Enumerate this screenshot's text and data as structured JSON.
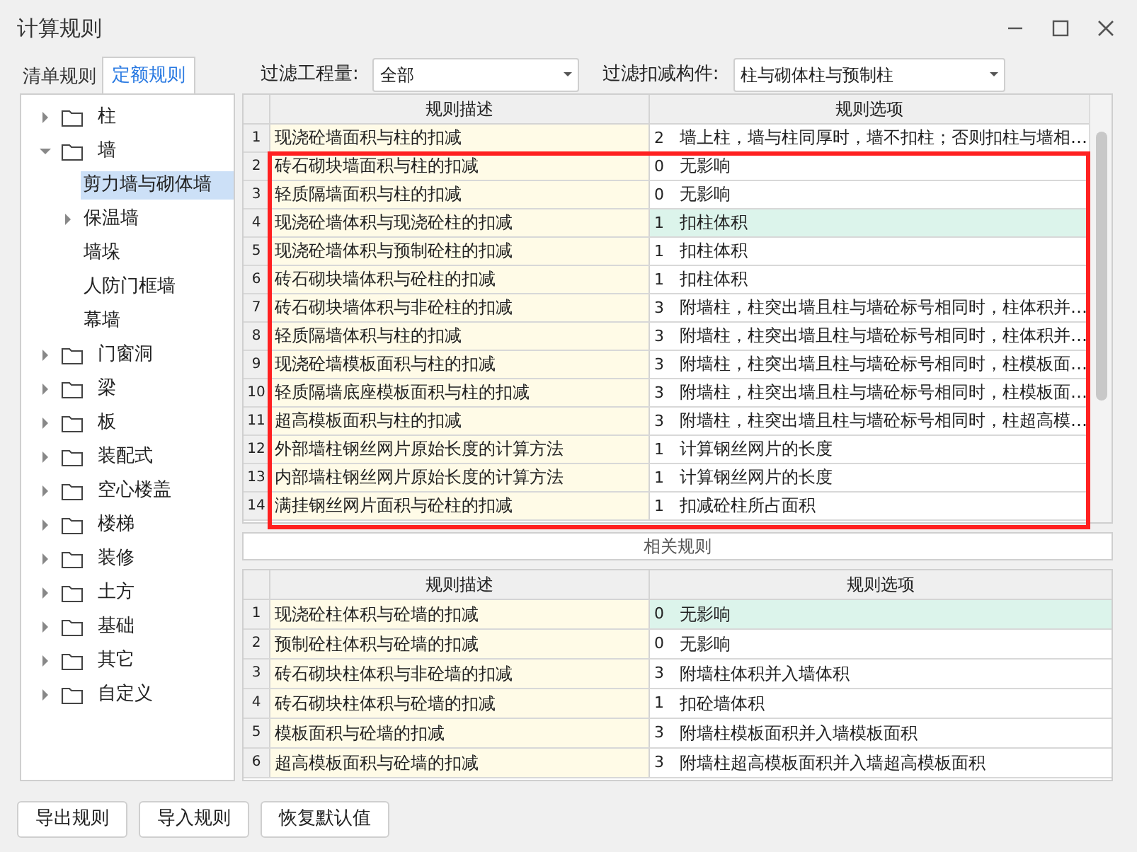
{
  "window": {
    "title": "计算规则"
  },
  "tabs": [
    {
      "label": "清单规则",
      "selected": false
    },
    {
      "label": "定额规则",
      "selected": true
    }
  ],
  "filters": [
    {
      "label": "过滤工程量:",
      "value": "全部"
    },
    {
      "label": "过滤扣减构件:",
      "value": "柱与砌体柱与预制柱"
    }
  ],
  "tree": [
    {
      "label": "柱",
      "folder": true,
      "has_children": true,
      "expanded": false,
      "selected": false
    },
    {
      "label": "墙",
      "folder": true,
      "has_children": true,
      "expanded": true,
      "selected": false,
      "children": [
        {
          "label": "剪力墙与砌体墙",
          "folder": false,
          "has_children": false,
          "expanded": false,
          "selected": true
        },
        {
          "label": "保温墙",
          "folder": false,
          "has_children": true,
          "expanded": false,
          "selected": false
        },
        {
          "label": "墙垛",
          "folder": false,
          "has_children": false,
          "expanded": false,
          "selected": false
        },
        {
          "label": "人防门框墙",
          "folder": false,
          "has_children": false,
          "expanded": false,
          "selected": false
        },
        {
          "label": "幕墙",
          "folder": false,
          "has_children": false,
          "expanded": false,
          "selected": false
        }
      ]
    },
    {
      "label": "门窗洞",
      "folder": true,
      "has_children": true,
      "expanded": false,
      "selected": false
    },
    {
      "label": "梁",
      "folder": true,
      "has_children": true,
      "expanded": false,
      "selected": false
    },
    {
      "label": "板",
      "folder": true,
      "has_children": true,
      "expanded": false,
      "selected": false
    },
    {
      "label": "装配式",
      "folder": true,
      "has_children": true,
      "expanded": false,
      "selected": false
    },
    {
      "label": "空心楼盖",
      "folder": true,
      "has_children": true,
      "expanded": false,
      "selected": false
    },
    {
      "label": "楼梯",
      "folder": true,
      "has_children": true,
      "expanded": false,
      "selected": false
    },
    {
      "label": "装修",
      "folder": true,
      "has_children": true,
      "expanded": false,
      "selected": false
    },
    {
      "label": "土方",
      "folder": true,
      "has_children": true,
      "expanded": false,
      "selected": false
    },
    {
      "label": "基础",
      "folder": true,
      "has_children": true,
      "expanded": false,
      "selected": false
    },
    {
      "label": "其它",
      "folder": true,
      "has_children": true,
      "expanded": false,
      "selected": false
    },
    {
      "label": "自定义",
      "folder": true,
      "has_children": true,
      "expanded": false,
      "selected": false
    }
  ],
  "rules_table": {
    "columns": [
      "规则描述",
      "规则选项"
    ],
    "rows": [
      {
        "index": "1",
        "description": "现浇砼墙面积与柱的扣减",
        "code": "2",
        "option": "墙上柱，墙与柱同厚时，墙不扣柱；否则扣柱与墙相…",
        "selected": false
      },
      {
        "index": "2",
        "description": "砖石砌块墙面积与柱的扣减",
        "code": "0",
        "option": "无影响",
        "selected": false
      },
      {
        "index": "3",
        "description": "轻质隔墙面积与柱的扣减",
        "code": "0",
        "option": "无影响",
        "selected": false
      },
      {
        "index": "4",
        "description": "现浇砼墙体积与现浇砼柱的扣减",
        "code": "1",
        "option": "扣柱体积",
        "selected": true
      },
      {
        "index": "5",
        "description": "现浇砼墙体积与预制砼柱的扣减",
        "code": "1",
        "option": "扣柱体积",
        "selected": false
      },
      {
        "index": "6",
        "description": "砖石砌块墙体积与砼柱的扣减",
        "code": "1",
        "option": "扣柱体积",
        "selected": false
      },
      {
        "index": "7",
        "description": "砖石砌块墙体积与非砼柱的扣减",
        "code": "3",
        "option": "附墙柱，柱突出墙且柱与墙砼标号相同时，柱体积并…",
        "selected": false
      },
      {
        "index": "8",
        "description": "轻质隔墙体积与柱的扣减",
        "code": "3",
        "option": "附墙柱，柱突出墙且柱与墙砼标号相同时，柱体积并…",
        "selected": false
      },
      {
        "index": "9",
        "description": "现浇砼墙模板面积与柱的扣减",
        "code": "3",
        "option": "附墙柱，柱突出墙且柱与墙砼标号相同时，柱模板面…",
        "selected": false
      },
      {
        "index": "10",
        "description": "轻质隔墙底座模板面积与柱的扣减",
        "code": "3",
        "option": "附墙柱，柱突出墙且柱与墙砼标号相同时，柱模板面…",
        "selected": false
      },
      {
        "index": "11",
        "description": "超高模板面积与柱的扣减",
        "code": "3",
        "option": "附墙柱，柱突出墙且柱与墙砼标号相同时，柱超高模…",
        "selected": false
      },
      {
        "index": "12",
        "description": "外部墙柱钢丝网片原始长度的计算方法",
        "code": "1",
        "option": "计算钢丝网片的长度",
        "selected": false
      },
      {
        "index": "13",
        "description": "内部墙柱钢丝网片原始长度的计算方法",
        "code": "1",
        "option": "计算钢丝网片的长度",
        "selected": false
      },
      {
        "index": "14",
        "description": "满挂钢丝网片面积与砼柱的扣减",
        "code": "1",
        "option": "扣减砼柱所占面积",
        "selected": false
      }
    ]
  },
  "related_label": "相关规则",
  "related_table": {
    "columns": [
      "规则描述",
      "规则选项"
    ],
    "rows": [
      {
        "index": "1",
        "description": "现浇砼柱体积与砼墙的扣减",
        "code": "0",
        "option": "无影响",
        "selected": true
      },
      {
        "index": "2",
        "description": "预制砼柱体积与砼墙的扣减",
        "code": "0",
        "option": "无影响",
        "selected": false
      },
      {
        "index": "3",
        "description": "砖石砌块柱体积与非砼墙的扣减",
        "code": "3",
        "option": "附墙柱体积并入墙体积",
        "selected": false
      },
      {
        "index": "4",
        "description": "砖石砌块柱体积与砼墙的扣减",
        "code": "1",
        "option": "扣砼墙体积",
        "selected": false
      },
      {
        "index": "5",
        "description": "模板面积与砼墙的扣减",
        "code": "3",
        "option": "附墙柱模板面积并入墙模板面积",
        "selected": false
      },
      {
        "index": "6",
        "description": "超高模板面积与砼墙的扣减",
        "code": "3",
        "option": "附墙柱超高模板面积并入墙超高模板面积",
        "selected": false
      }
    ]
  },
  "buttons": [
    "导出规则",
    "导入规则",
    "恢复默认值"
  ],
  "annotation": {
    "kind": "rectangle"
  }
}
